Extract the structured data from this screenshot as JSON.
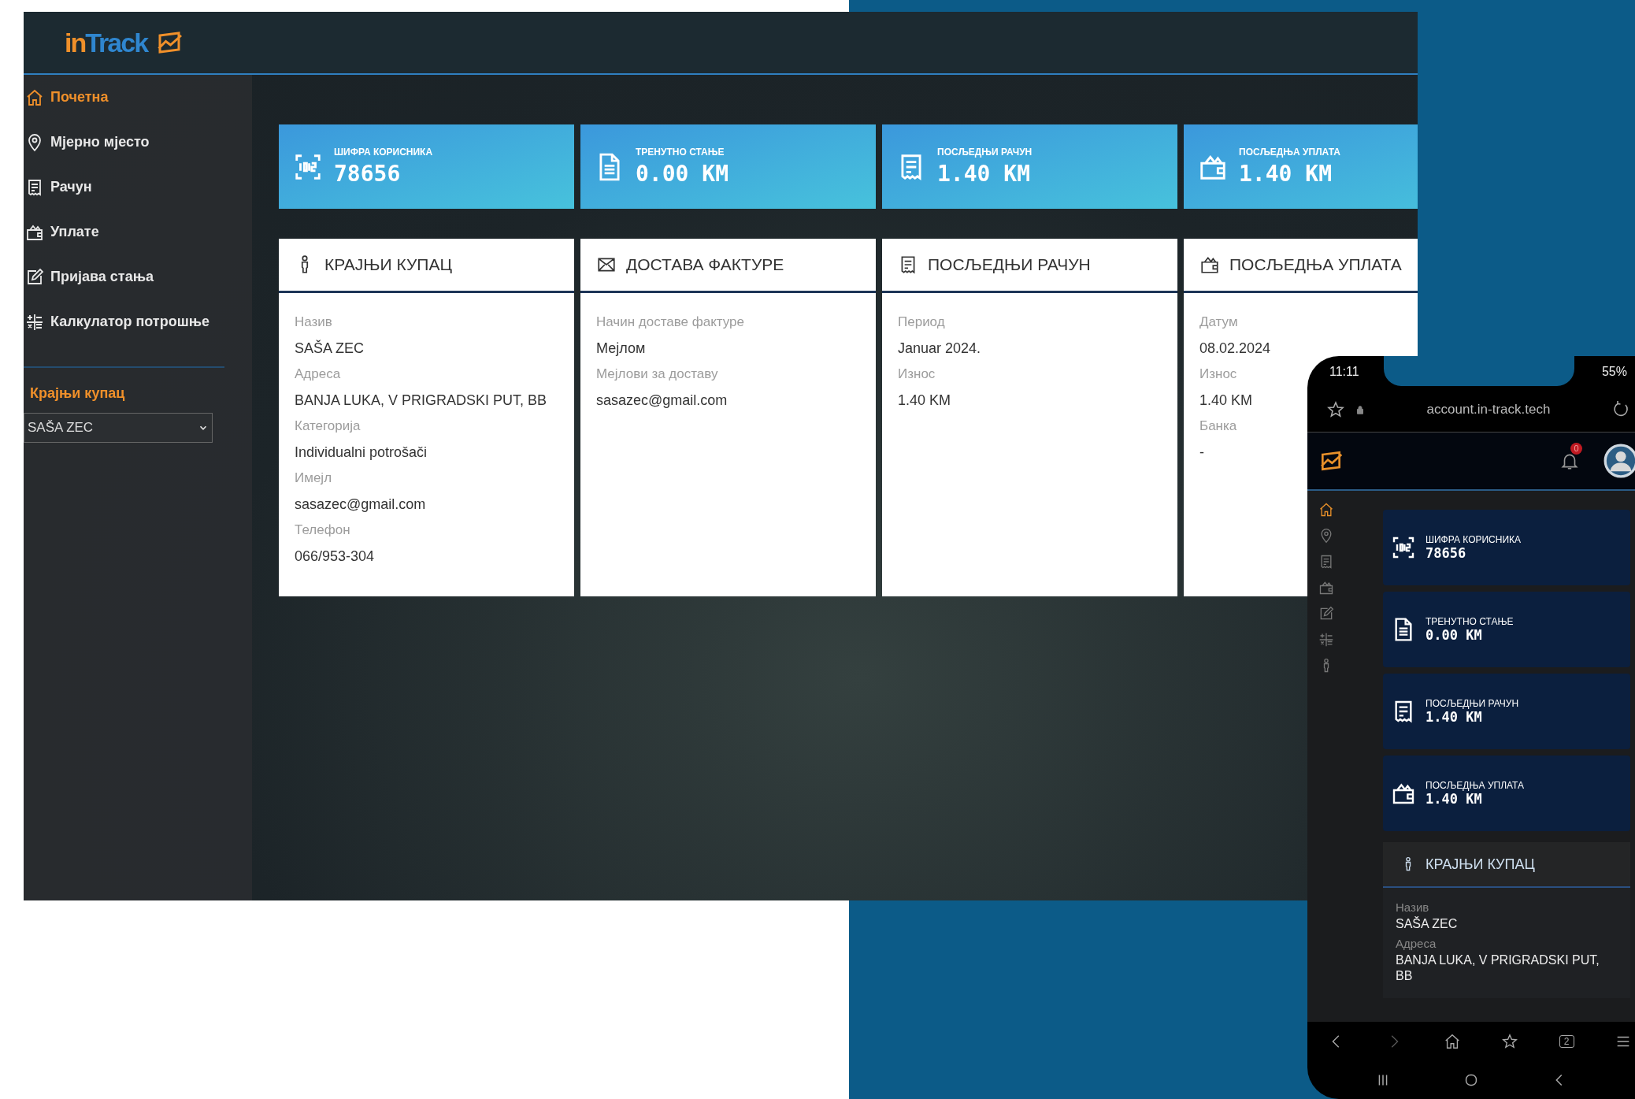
{
  "desktop": {
    "logo": {
      "prefix": "in",
      "main": "Track"
    },
    "sidebar": {
      "items": [
        {
          "label": "Почетна",
          "selected": true
        },
        {
          "label": "Мјерно мјесто",
          "selected": false
        },
        {
          "label": "Рачун",
          "selected": false
        },
        {
          "label": "Уплате",
          "selected": false
        },
        {
          "label": "Пријава стања",
          "selected": false
        },
        {
          "label": "Калкулатор потрошње",
          "selected": false
        }
      ],
      "section_label": "Крајњи купац",
      "customer_select": {
        "value": "SAŠA ZEC"
      }
    },
    "stat_cards": [
      {
        "label": "ШИФРА КОРИСНИКА",
        "value": "78656"
      },
      {
        "label": "ТРЕНУТНО СТАЊЕ",
        "value": "0.00 KM"
      },
      {
        "label": "ПОСЉЕДЊИ РАЧУН",
        "value": "1.40 KM"
      },
      {
        "label": "ПОСЉЕДЊА УПЛАТА",
        "value": "1.40 KM"
      }
    ],
    "detail_cards": [
      {
        "title": "КРАЈЊИ КУПАЦ",
        "fields": [
          {
            "label": "Назив",
            "value": "SAŠA ZEC"
          },
          {
            "label": "Адреса",
            "value": "BANJA LUKA, V PRIGRADSKI PUT, BB"
          },
          {
            "label": "Категорија",
            "value": "Individualni potrošači"
          },
          {
            "label": "Имејл",
            "value": "sasazec@gmail.com"
          },
          {
            "label": "Телефон",
            "value": "066/953-304"
          }
        ]
      },
      {
        "title": "ДОСТАВА ФАКТУРЕ",
        "fields": [
          {
            "label": "Начин доставе фактуре",
            "value": "Мејлом"
          },
          {
            "label": "Мејлови за доставу",
            "value": "sasazec@gmail.com"
          }
        ]
      },
      {
        "title": "ПОСЉЕДЊИ РАЧУН",
        "fields": [
          {
            "label": "Период",
            "value": "Januar 2024."
          },
          {
            "label": "Износ",
            "value": "1.40 KM"
          }
        ]
      },
      {
        "title": "ПОСЉЕДЊА УПЛАТА",
        "fields": [
          {
            "label": "Датум",
            "value": "08.02.2024"
          },
          {
            "label": "Износ",
            "value": "1.40 KM"
          },
          {
            "label": "Банка",
            "value": "-"
          }
        ]
      }
    ]
  },
  "phone": {
    "status_bar": {
      "time": "11:11",
      "battery": "55%"
    },
    "browser": {
      "url": "account.in-track.tech",
      "tabs_count": "2"
    },
    "notification_count": "0",
    "nav_items": [
      {
        "selected": true
      },
      {
        "selected": false
      },
      {
        "selected": false
      },
      {
        "selected": false
      },
      {
        "selected": false
      },
      {
        "selected": false
      },
      {
        "selected": false
      }
    ],
    "stat_cards": [
      {
        "label": "ШИФРА КОРИСНИКА",
        "value": "78656"
      },
      {
        "label": "ТРЕНУТНО СТАЊЕ",
        "value": "0.00 KM"
      },
      {
        "label": "ПОСЉЕДЊИ РАЧУН",
        "value": "1.40 KM"
      },
      {
        "label": "ПОСЉЕДЊА УПЛАТА",
        "value": "1.40 KM"
      }
    ],
    "customer_card": {
      "title": "КРАЈЊИ КУПАЦ",
      "fields": [
        {
          "label": "Назив",
          "value": "SAŠA ZEC"
        },
        {
          "label": "Адреса",
          "value": "BANJA LUKA, V PRIGRADSKI PUT, BB"
        }
      ]
    }
  }
}
